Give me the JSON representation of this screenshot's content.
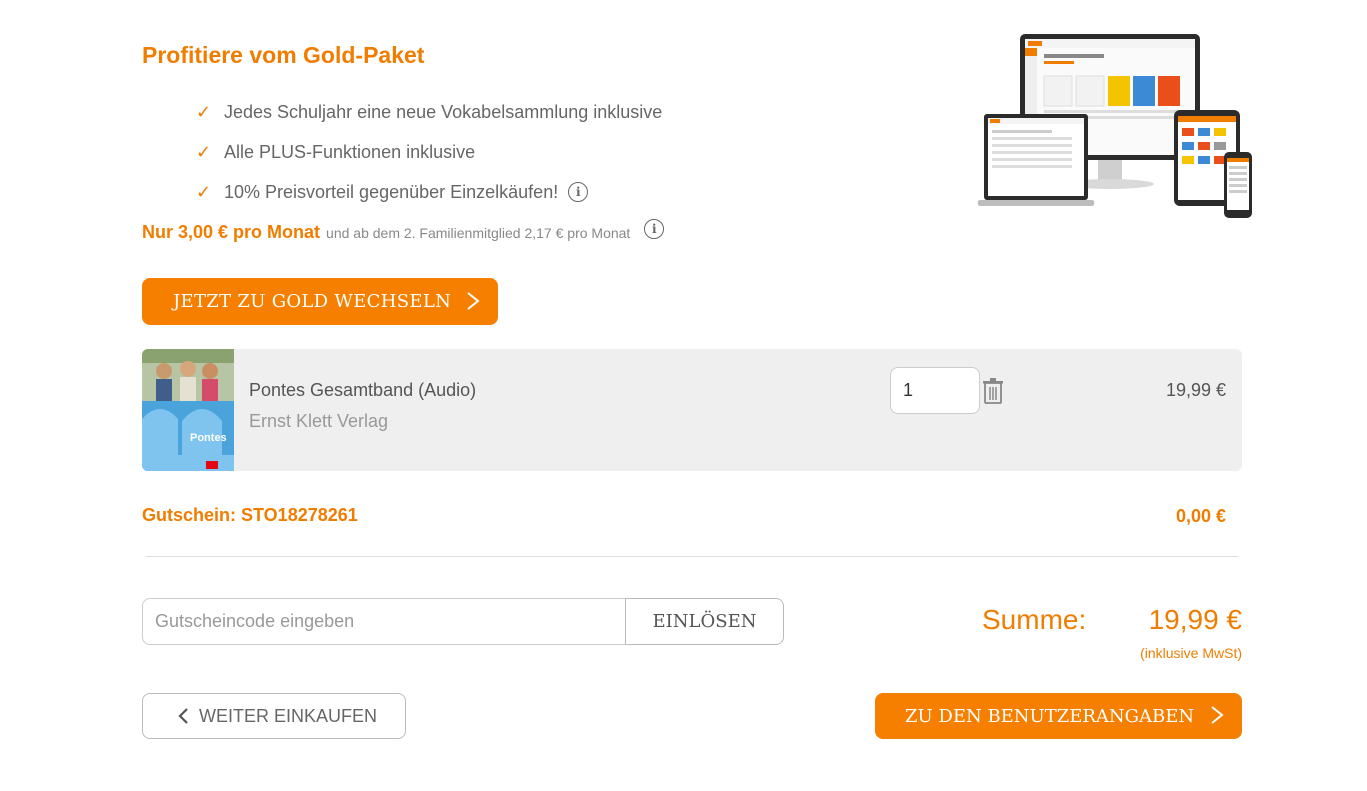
{
  "promo": {
    "title": "Profitiere vom Gold-Paket",
    "benefits": [
      "Jedes Schuljahr eine neue Vokabelsammlung inklusive",
      "Alle PLUS-Funktionen inklusive",
      "10% Preisvorteil gegenüber Einzelkäufen!"
    ],
    "price_strong": "Nur 3,00 € pro Monat",
    "price_note": "und ab dem 2. Familienmitglied 2,17 € pro Monat",
    "button_label": "JETZT ZU GOLD WECHSELN"
  },
  "cart": {
    "item": {
      "title": "Pontes Gesamtband (Audio)",
      "publisher": "Ernst Klett Verlag",
      "quantity": "1",
      "price": "19,99 €",
      "cover_text": "Pontes"
    },
    "voucher": {
      "label": "Gutschein: STO18278261",
      "amount": "0,00 €"
    },
    "code_input": {
      "placeholder": "Gutscheincode eingeben",
      "value": ""
    },
    "redeem_label": "EINLÖSEN",
    "sum_label": "Summe:",
    "sum_value": "19,99 €",
    "vat_note": "(inklusive MwSt)"
  },
  "nav": {
    "back_label": "WEITER EINKAUFEN",
    "next_label": "ZU DEN BENUTZERANGABEN"
  },
  "icons": {
    "check": "check-icon",
    "info": "info-icon",
    "trash": "trash-icon",
    "chevron_right": "chevron-right-icon",
    "chevron_left": "chevron-left-icon"
  },
  "colors": {
    "accent": "#f77f00",
    "item_bg": "#efefef"
  }
}
